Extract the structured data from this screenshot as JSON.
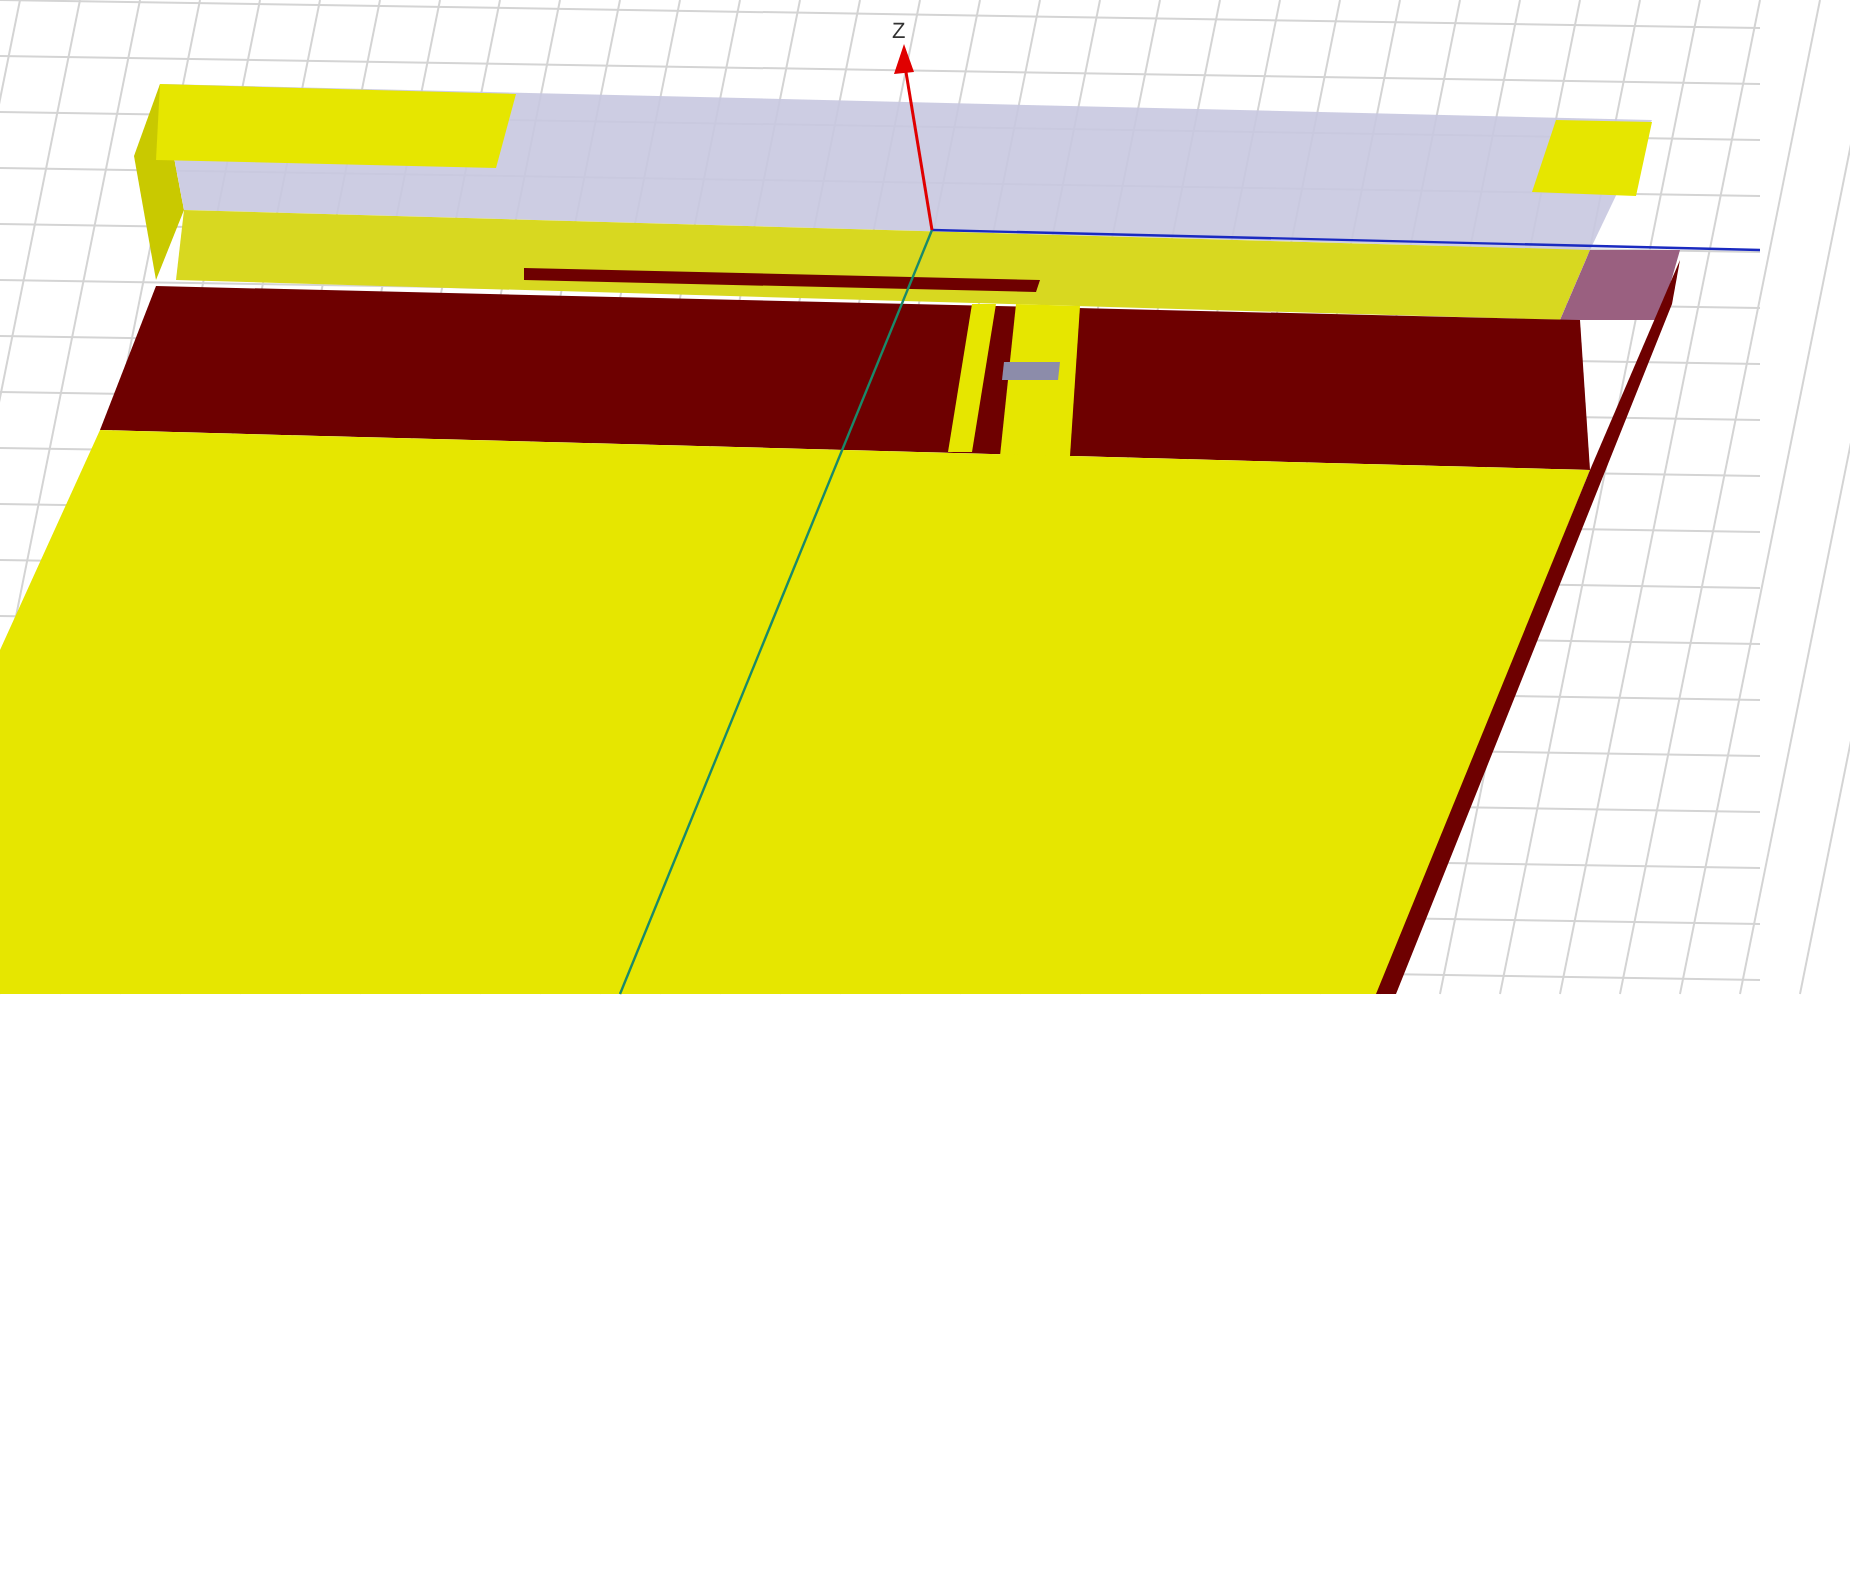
{
  "viewport": {
    "axis_label": "Z"
  }
}
